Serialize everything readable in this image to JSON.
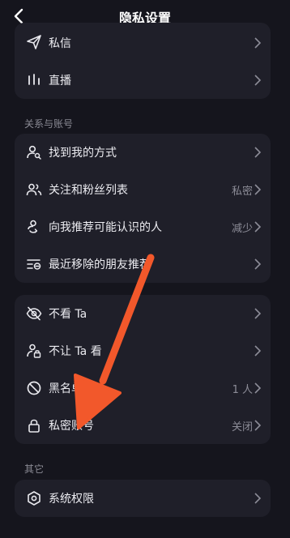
{
  "header": {
    "title": "隐私设置"
  },
  "group1": {
    "items": [
      {
        "label": "私信",
        "value": ""
      },
      {
        "label": "直播",
        "value": ""
      }
    ]
  },
  "section_relations": {
    "title": "关系与账号"
  },
  "group2": {
    "items": [
      {
        "label": "找到我的方式",
        "value": ""
      },
      {
        "label": "关注和粉丝列表",
        "value": "私密"
      },
      {
        "label": "向我推荐可能认识的人",
        "value": "减少"
      },
      {
        "label": "最近移除的朋友推荐",
        "value": ""
      }
    ]
  },
  "group3": {
    "items": [
      {
        "label": "不看 Ta",
        "value": ""
      },
      {
        "label": "不让 Ta 看",
        "value": ""
      },
      {
        "label": "黑名单",
        "value": "1 人"
      },
      {
        "label": "私密账号",
        "value": "关闭"
      }
    ]
  },
  "section_other": {
    "title": "其它"
  },
  "group4": {
    "items": [
      {
        "label": "系统权限",
        "value": ""
      }
    ]
  },
  "colors": {
    "background": "#15151d",
    "card": "#1f1f29",
    "annotation_arrow": "#f2582b"
  }
}
